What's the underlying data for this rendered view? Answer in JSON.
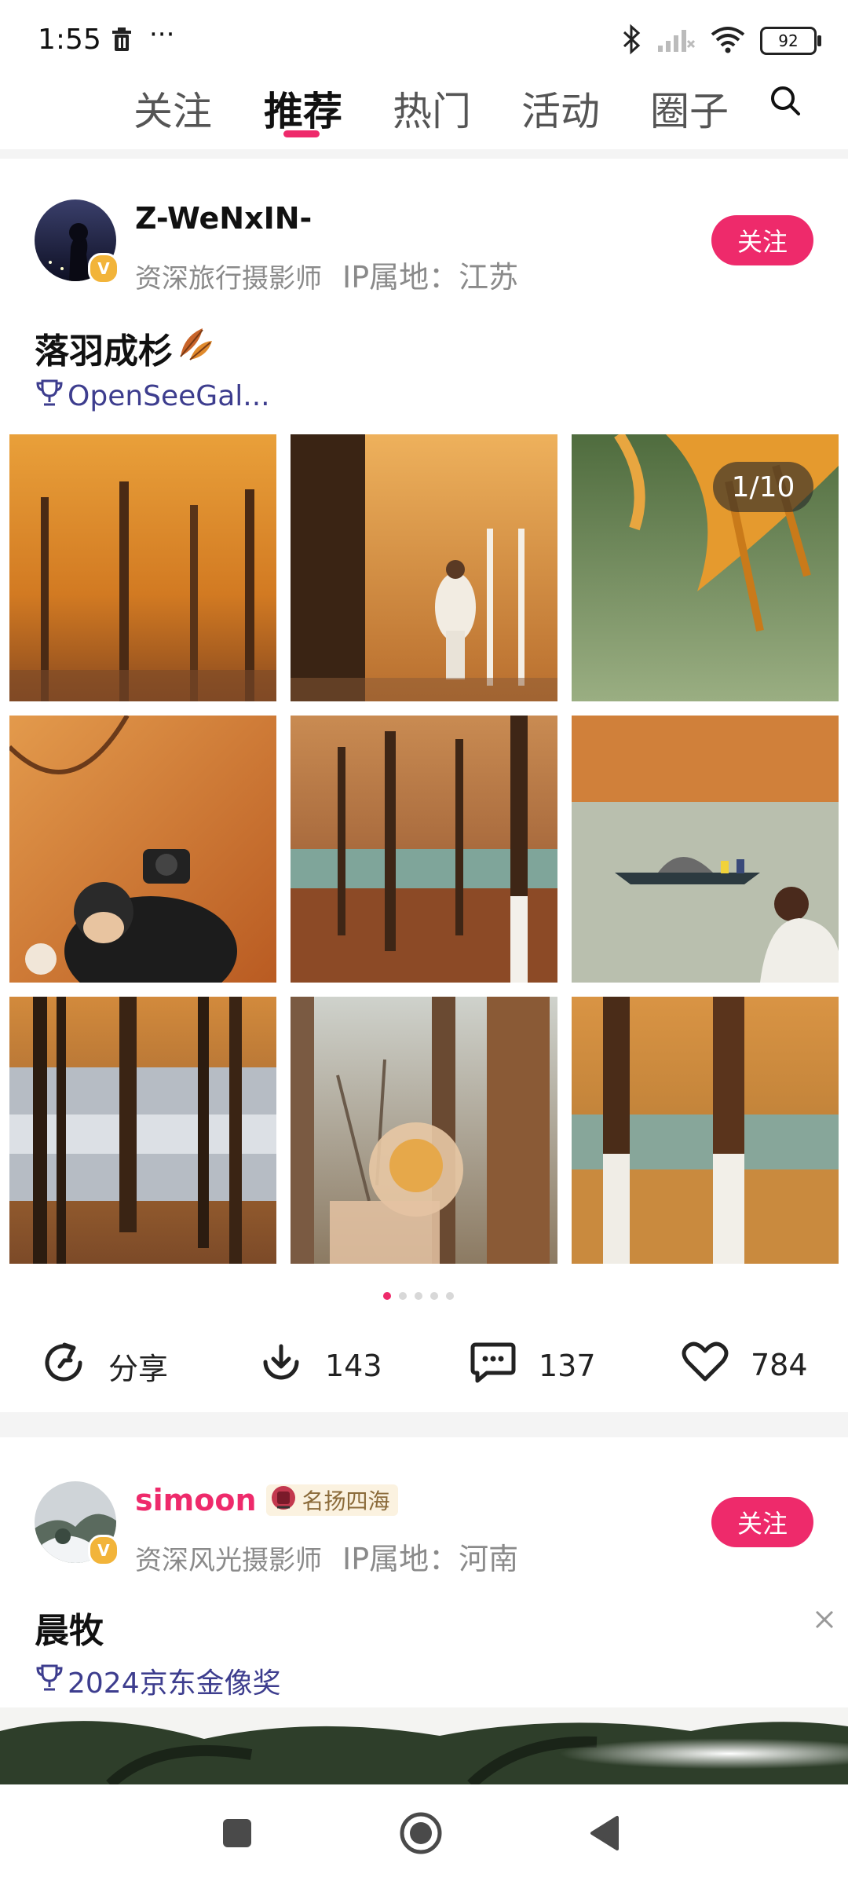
{
  "status_bar": {
    "time": "1:55",
    "more": "···",
    "battery": "92",
    "icons": [
      "trash-icon",
      "bluetooth-icon",
      "signal-icon",
      "wifi-icon",
      "battery-icon"
    ]
  },
  "tabs": [
    {
      "label": "关注",
      "active": false
    },
    {
      "label": "推荐",
      "active": true
    },
    {
      "label": "热门",
      "active": false
    },
    {
      "label": "活动",
      "active": false
    },
    {
      "label": "圈子",
      "active": false
    }
  ],
  "accent_color": "#ee2a6b",
  "post1": {
    "username": "Z-WeNxIN-",
    "role": "资深旅行摄影师",
    "ip": "IP属地：江苏",
    "follow_label": "关注",
    "title": "落羽成杉",
    "award": "OpenSeeGal...",
    "counter": "1/10",
    "page_dots": 5,
    "active_dot": 0,
    "actions": {
      "share": "分享",
      "download": "143",
      "comments": "137",
      "likes": "784"
    }
  },
  "post2": {
    "username": "simoon",
    "badge": "名扬四海",
    "role": "资深风光摄影师",
    "ip": "IP属地：河南",
    "follow_label": "关注",
    "title": "晨牧",
    "award": "2024京东金像奖"
  },
  "nav_bar": {
    "icons": [
      "recents-square-icon",
      "home-circle-icon",
      "back-triangle-icon"
    ]
  }
}
